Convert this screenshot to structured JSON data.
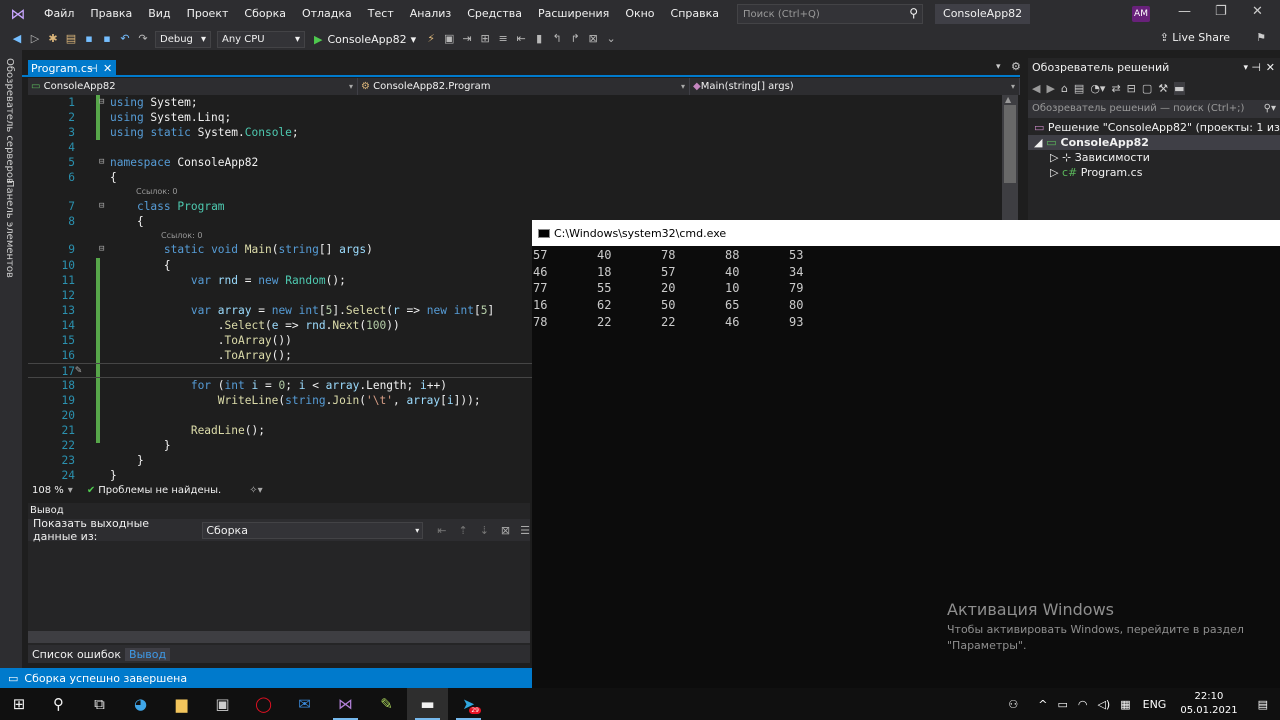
{
  "menubar": {
    "items": [
      "Файл",
      "Правка",
      "Вид",
      "Проект",
      "Сборка",
      "Отладка",
      "Тест",
      "Анализ",
      "Средства",
      "Расширения",
      "Окно",
      "Справка"
    ],
    "search_placeholder": "Поиск (Ctrl+Q)",
    "solution_name": "ConsoleApp82",
    "avatar": "AM"
  },
  "toolbar": {
    "config": "Debug",
    "platform": "Any CPU",
    "start_label": "ConsoleApp82",
    "live_share": "Live Share"
  },
  "side_strip": {
    "server_explorer": "Обозреватель серверов",
    "toolbox": "Панель элементов"
  },
  "editor": {
    "tab_label": "Program.cs",
    "nav_project": "ConsoleApp82",
    "nav_class": "ConsoleApp82.Program",
    "nav_method": "Main(string[] args)",
    "refs_label": "Ссылок: 0",
    "zoom": "108 %",
    "issues": "Проблемы не найдены."
  },
  "output": {
    "title": "Вывод",
    "show_from_label": "Показать выходные данные из:",
    "source": "Сборка",
    "tabs": [
      "Список ошибок",
      "Вывод"
    ]
  },
  "statusbar": {
    "text": "Сборка успешно завершена"
  },
  "solution_explorer": {
    "title": "Обозреватель решений",
    "search_placeholder": "Обозреватель решений — поиск (Ctrl+;)",
    "solution": "Решение \"ConsoleApp82\" (проекты: 1 из 1)",
    "project": "ConsoleApp82",
    "deps": "Зависимости",
    "file": "Program.cs"
  },
  "cmd": {
    "title": "C:\\Windows\\system32\\cmd.exe",
    "rows": [
      [
        "57",
        "40",
        "78",
        "88",
        "53"
      ],
      [
        "46",
        "18",
        "57",
        "40",
        "34"
      ],
      [
        "77",
        "55",
        "20",
        "10",
        "79"
      ],
      [
        "16",
        "62",
        "50",
        "65",
        "80"
      ],
      [
        "78",
        "22",
        "22",
        "46",
        "93"
      ]
    ]
  },
  "activation": {
    "title": "Активация Windows",
    "line1": "Чтобы активировать Windows, перейдите в раздел",
    "line2": "\"Параметры\"."
  },
  "taskbar": {
    "lang": "ENG",
    "time": "22:10",
    "date": "05.01.2021",
    "badge": "29"
  }
}
